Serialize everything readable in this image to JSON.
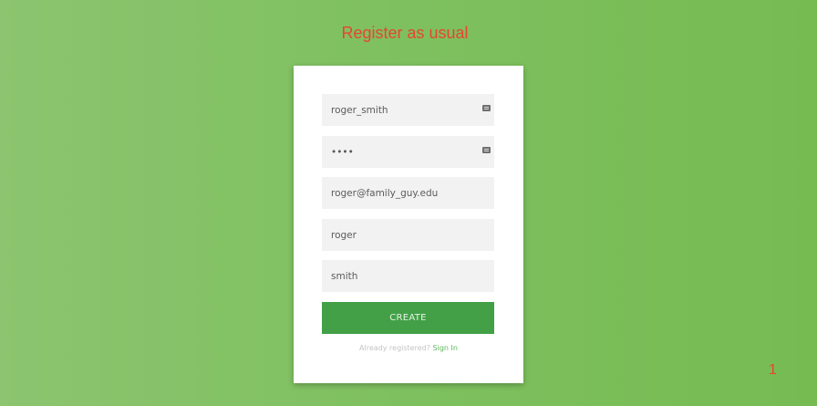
{
  "heading": "Register as usual",
  "form": {
    "username": "roger_smith",
    "password": "••••",
    "email": "roger@family_guy.edu",
    "first_name": "roger",
    "last_name": "smith",
    "create_label": "CREATE",
    "already_registered": "Already registered?",
    "sign_in_label": "Sign In"
  },
  "icons": {
    "autofill": "keyboard-icon"
  },
  "page_number": "1",
  "colors": {
    "heading": "#e8452f",
    "button": "#43a047",
    "link": "#5cb85c",
    "background": "#7ec05f"
  }
}
